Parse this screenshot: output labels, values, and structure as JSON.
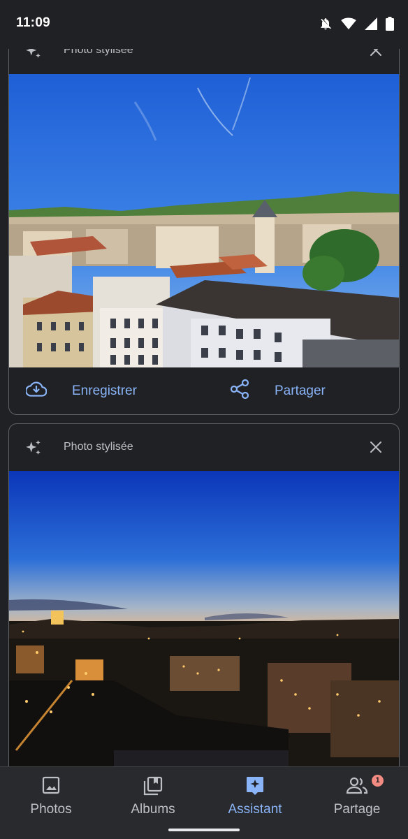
{
  "status_bar": {
    "time": "11:09",
    "icons": [
      "bell-off-icon",
      "wifi-icon",
      "signal-icon",
      "battery-icon"
    ]
  },
  "cards": [
    {
      "title": "Photo stylisée",
      "icon": "sparkle-icon",
      "close_icon": "close-icon",
      "photo": "Stylized daytime city skyline with blue sky, rooftops and church bell tower",
      "actions": [
        {
          "label": "Enregistrer",
          "icon": "cloud-download-icon"
        },
        {
          "label": "Partager",
          "icon": "share-icon"
        }
      ]
    },
    {
      "title": "Photo stylisée",
      "icon": "sparkle-icon",
      "close_icon": "close-icon",
      "photo": "Stylized dusk city skyline with deep blue sky and lit buildings"
    }
  ],
  "bottom_nav": {
    "items": [
      {
        "label": "Photos",
        "icon": "photo-icon",
        "active": false
      },
      {
        "label": "Albums",
        "icon": "albums-icon",
        "active": false
      },
      {
        "label": "Assistant",
        "icon": "assistant-icon",
        "active": true
      },
      {
        "label": "Partage",
        "icon": "people-icon",
        "active": false,
        "badge": "1"
      }
    ]
  },
  "colors": {
    "background": "#202124",
    "accent": "#8ab4f8",
    "badge": "#f28b82",
    "card_border": "#5f6368"
  }
}
